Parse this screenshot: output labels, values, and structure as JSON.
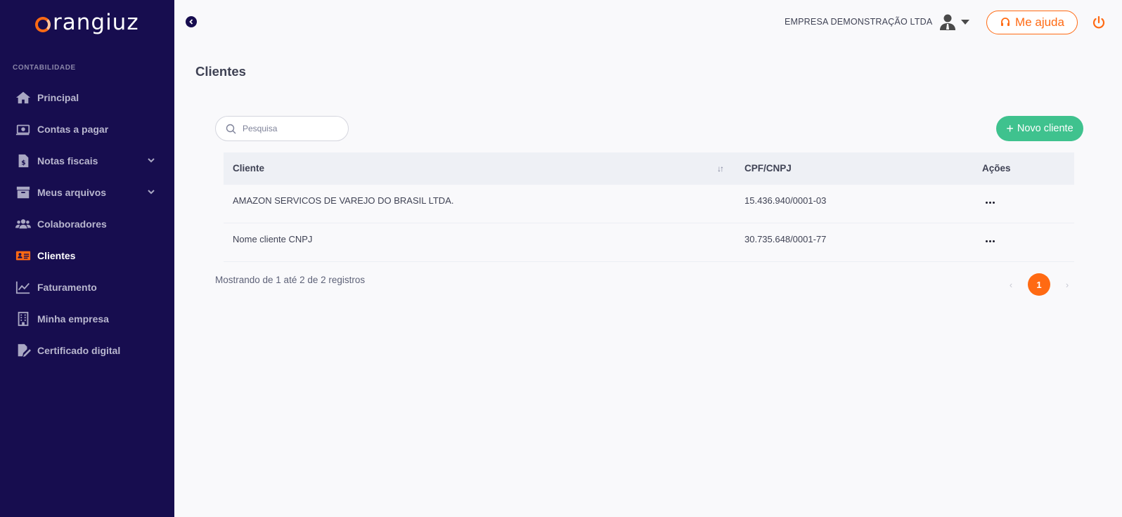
{
  "brand": {
    "name": "rangiuz",
    "accent": "#ff6a13",
    "sidebar_bg": "#170d4f"
  },
  "sidebar": {
    "section_label": "CONTABILIDADE",
    "items": [
      {
        "label": "Principal",
        "icon": "home-icon"
      },
      {
        "label": "Contas a pagar",
        "icon": "money-icon"
      },
      {
        "label": "Notas fiscais",
        "icon": "invoice-icon",
        "expandable": true
      },
      {
        "label": "Meus arquivos",
        "icon": "archive-icon",
        "expandable": true
      },
      {
        "label": "Colaboradores",
        "icon": "users-icon"
      },
      {
        "label": "Clientes",
        "icon": "id-card-icon",
        "active": true
      },
      {
        "label": "Faturamento",
        "icon": "chart-line-icon"
      },
      {
        "label": "Minha empresa",
        "icon": "building-icon"
      },
      {
        "label": "Certificado digital",
        "icon": "certificate-icon"
      }
    ]
  },
  "header": {
    "company": "EMPRESA DEMONSTRAÇÃO LTDA",
    "help_label": "Me ajuda"
  },
  "page": {
    "title": "Clientes"
  },
  "toolbar": {
    "search_placeholder": "Pesquisa",
    "new_button_label": "Novo cliente",
    "new_button_color": "#3fc28e"
  },
  "table": {
    "columns": [
      "Cliente",
      "CPF/CNPJ",
      "Ações"
    ],
    "rows": [
      {
        "cliente": "AMAZON SERVICOS DE VAREJO DO BRASIL LTDA.",
        "documento": "15.436.940/0001-03"
      },
      {
        "cliente": "Nome cliente CNPJ",
        "documento": "30.735.648/0001-77"
      }
    ]
  },
  "footer": {
    "summary": "Mostrando de 1 até 2 de 2 registros",
    "current_page": "1"
  }
}
